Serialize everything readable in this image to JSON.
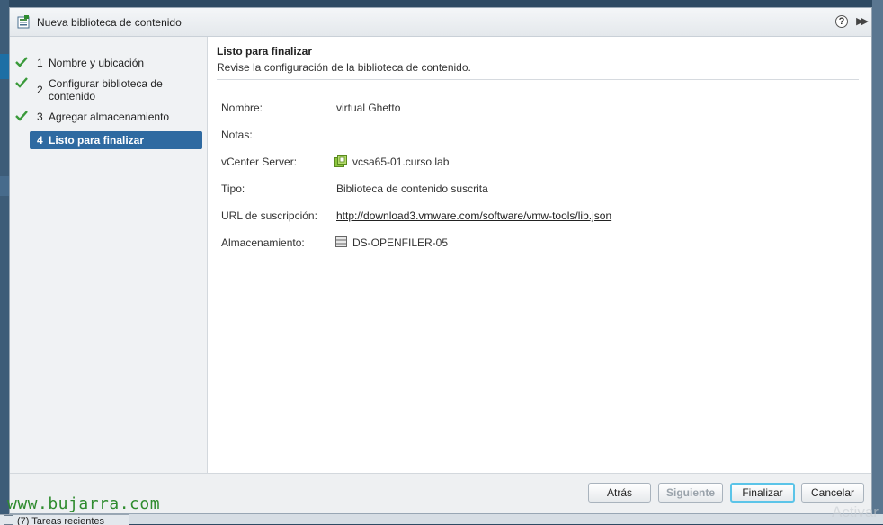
{
  "dialog": {
    "title": "Nueva biblioteca de contenido",
    "help_glyph": "?",
    "collapse_glyph": "▶▶"
  },
  "steps": [
    {
      "num": "1",
      "label": "Nombre y ubicación",
      "done": true
    },
    {
      "num": "2",
      "label": "Configurar biblioteca de contenido",
      "done": true
    },
    {
      "num": "3",
      "label": "Agregar almacenamiento",
      "done": true
    },
    {
      "num": "4",
      "label": "Listo para finalizar",
      "active": true
    }
  ],
  "content": {
    "title": "Listo para finalizar",
    "subtitle": "Revise la configuración de la biblioteca de contenido.",
    "rows": [
      {
        "key": "Nombre:",
        "value": "virtual Ghetto"
      },
      {
        "key": "Notas:",
        "value": ""
      },
      {
        "key": "vCenter Server:",
        "value": "vcsa65-01.curso.lab",
        "icon": "vcenter-icon"
      },
      {
        "key": "Tipo:",
        "value": "Biblioteca de contenido suscrita"
      },
      {
        "key": "URL de suscripción:",
        "value": "http://download3.vmware.com/software/vmw-tools/lib.json"
      },
      {
        "key": "Almacenamiento:",
        "value": "DS-OPENFILER-05",
        "icon": "datastore-icon"
      }
    ]
  },
  "footer": {
    "back_label": "Atrás",
    "next_label": "Siguiente",
    "finish_label": "Finalizar",
    "cancel_label": "Cancelar"
  },
  "background": {
    "tasks_label": "(7) Tareas recientes",
    "watermark": "www.bujarra.com",
    "activate_text": "Activar"
  },
  "colors": {
    "active_step": "#2e6aa1",
    "check": "#3a9a3a",
    "primary_focus": "#5bc4e8"
  }
}
